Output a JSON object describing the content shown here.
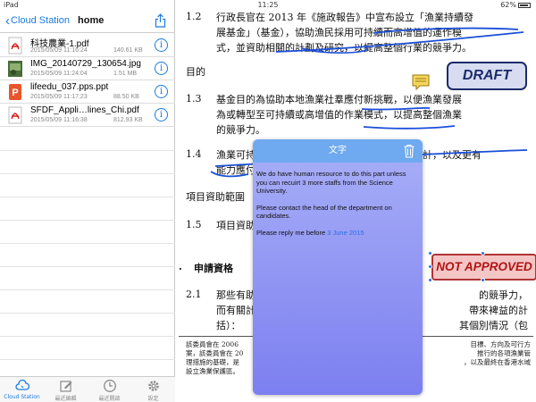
{
  "status": {
    "carrier": "iPad",
    "time": "11:25",
    "battery": "62%"
  },
  "sidebar": {
    "back_label": "Cloud Station",
    "title": "home",
    "files": [
      {
        "name": "科技農業-1.pdf",
        "date": "2015/05/09 11:16:24",
        "size": "140.61 KB",
        "type": "pdf"
      },
      {
        "name": "IMG_20140729_130654.jpg",
        "date": "2015/05/09 11:24:04",
        "size": "1.51 MB",
        "type": "image"
      },
      {
        "name": "lifeedu_037.pps.ppt",
        "date": "2015/05/09 11:17:23",
        "size": "88.50 KB",
        "type": "ppt"
      },
      {
        "name": "SFDF_Appli…lines_Chi.pdf",
        "date": "2015/05/09 11:16:38",
        "size": "812.93 KB",
        "type": "pdf"
      }
    ],
    "info_glyph": "i"
  },
  "tabs": [
    {
      "label": "Cloud Station",
      "icon": "cloud-station-icon",
      "active": true
    },
    {
      "label": "最近編輯",
      "icon": "edit-icon",
      "active": false
    },
    {
      "label": "最近開啟",
      "icon": "clock-icon",
      "active": false
    },
    {
      "label": "設定",
      "icon": "gear-icon",
      "active": false
    }
  ],
  "document": {
    "p12_num": "1.2",
    "p12_lines": [
      "行政長官在 2013 年《施政報告》中宣布設立「漁業持續發",
      "展基金」（基金），協助漁民採用可持續而高增值的運作模",
      "式，並資助相關的計劃及研究，以提高整個行業的競爭力。"
    ],
    "section_objective": "目的",
    "p13_num": "1.3",
    "p13_lines": [
      "基金目的為協助本地漁業社羣應付新挑戰，以便漁業發展",
      "為或轉型至可持續或高增值的作業模式，以提高整個漁業",
      "的競爭力。"
    ],
    "p14_num": "1.4",
    "p14_lines": [
      "漁業可持",
      "能力應付"
    ],
    "p14_right": [
      "計，以及更有",
      ""
    ],
    "section_scope": "項目資助範圍",
    "p15_num": "1.5",
    "p15_text": "項目資助",
    "section_apply": "申請資格",
    "p21_num": "2.1",
    "p21_lines": [
      "那些有助",
      "而有關計",
      "括）："
    ],
    "p21_right": [
      "的競爭力，",
      "帶來裨益的計",
      "其個別情況（包"
    ],
    "footnote_lines": [
      "該委員會在 2006",
      "案，該委員會在 20",
      "理措施的基礎，是",
      "設立漁業保護區。"
    ],
    "footnote_right": [
      "目標、方向及可行方",
      "推行的各項漁業管",
      "，以及最終在香港水域",
      ""
    ],
    "bullet": "."
  },
  "popup": {
    "title": "文字",
    "para1": "We do have human resource to do this part unless you can recuirt 3 more staffs from the Science University.",
    "para2": "Please contact the head of the department on candidates.",
    "para3_prefix": "Please reply me before",
    "para3_date": "3 June 2015"
  },
  "stamps": {
    "draft": "DRAFT",
    "not_approved": "NOT APPROVED"
  },
  "colors": {
    "accent": "#1a7be0",
    "popup_header": "#6fa9f0",
    "ink_underline": "#1a4fd8",
    "stamp_red": "#b01414",
    "stamp_navy": "#1c2b6b"
  }
}
